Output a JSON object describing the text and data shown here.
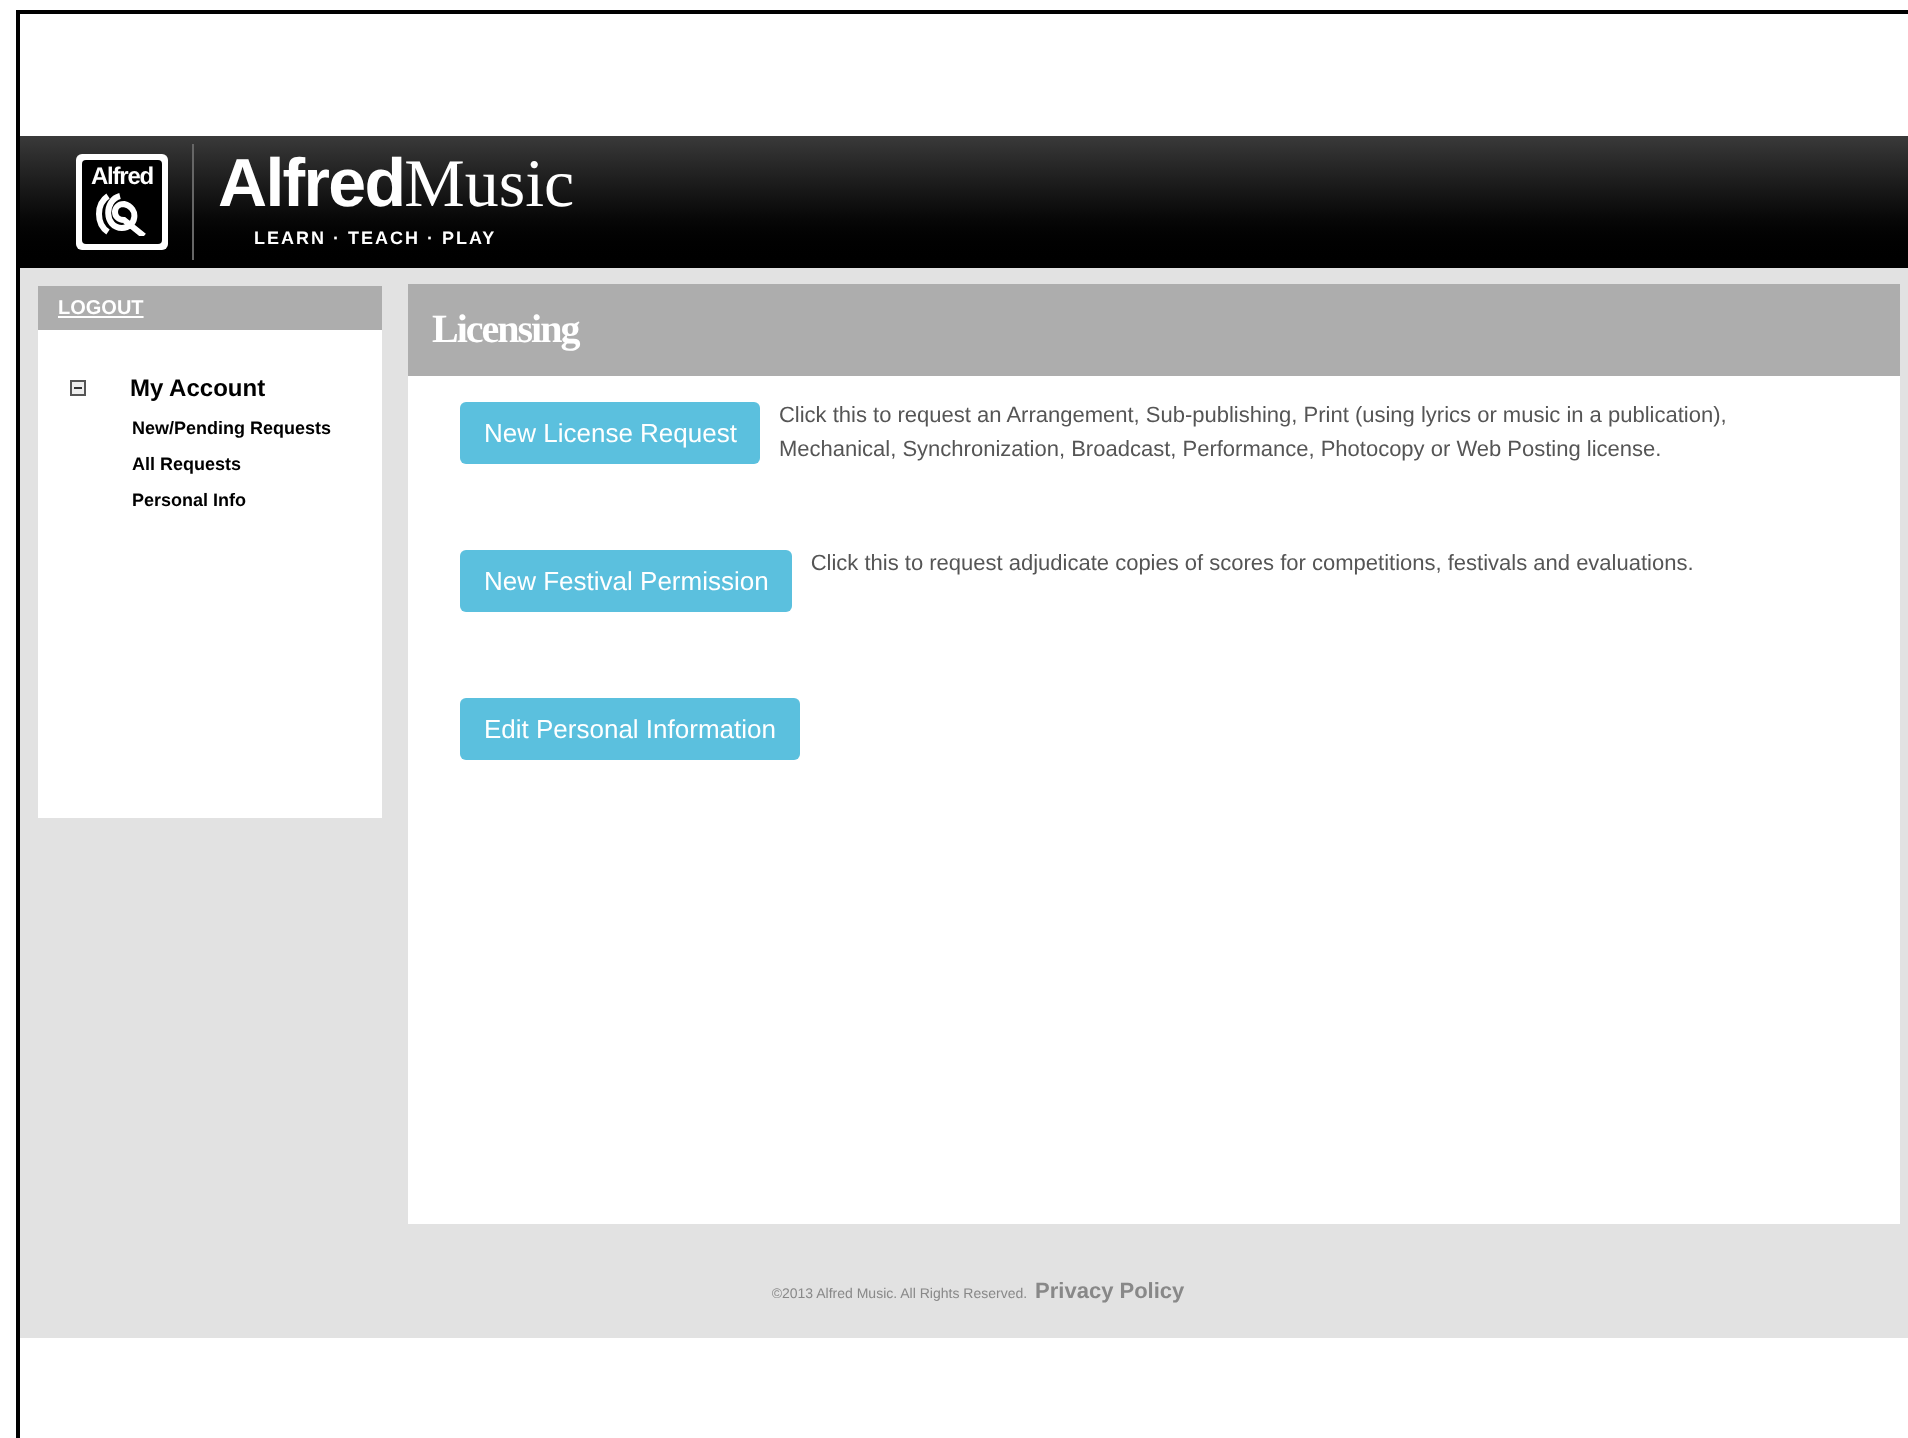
{
  "header": {
    "badge_text": "Alfred",
    "brand_bold": "Alfred",
    "brand_light": "Music",
    "tagline": "LEARN · TEACH · PLAY"
  },
  "sidebar": {
    "logout": "LOGOUT",
    "section": {
      "title": "My Account",
      "expanded": true
    },
    "items": [
      "New/Pending Requests",
      "All Requests",
      "Personal Info"
    ]
  },
  "main": {
    "title": "Licensing",
    "actions": [
      {
        "label": "New License Request",
        "description": "Click this to request an Arrangement, Sub-publishing, Print (using lyrics or music in a publication), Mechanical, Synchronization, Broadcast, Performance, Photocopy or Web Posting license."
      },
      {
        "label": "New Festival Permission",
        "description": "Click this to request adjudicate copies of scores for competitions, festivals and evaluations."
      },
      {
        "label": "Edit Personal Information"
      }
    ]
  },
  "footer": {
    "copyright": "©2013 Alfred Music. All Rights Reserved.",
    "link": "Privacy Policy"
  }
}
